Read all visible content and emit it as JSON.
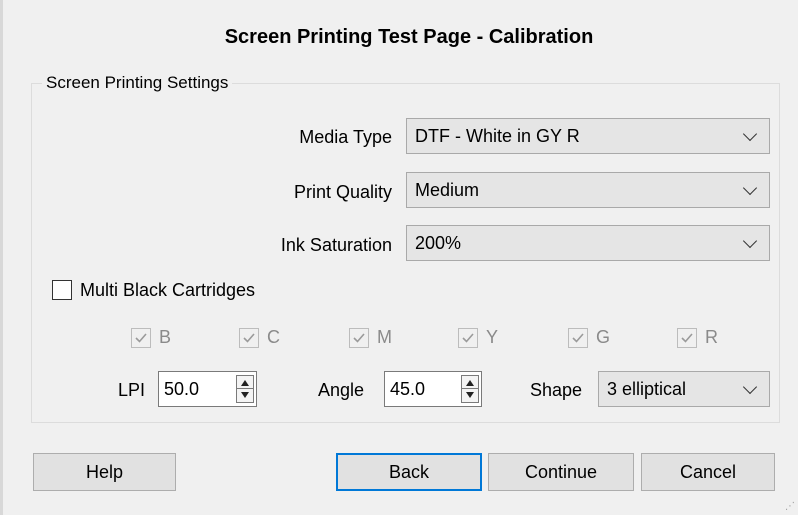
{
  "dialog": {
    "title": "Screen Printing Test Page - Calibration",
    "group_title": "Screen Printing Settings"
  },
  "settings": {
    "media_type": {
      "label": "Media Type",
      "value": "DTF - White in GY R"
    },
    "print_quality": {
      "label": "Print Quality",
      "value": "Medium"
    },
    "ink_saturation": {
      "label": "Ink Saturation",
      "value": "200%"
    }
  },
  "multi_black": {
    "label": "Multi Black Cartridges",
    "checked": false
  },
  "cartridges": [
    {
      "label": "B",
      "checked": true,
      "enabled": false
    },
    {
      "label": "C",
      "checked": true,
      "enabled": false
    },
    {
      "label": "M",
      "checked": true,
      "enabled": false
    },
    {
      "label": "Y",
      "checked": true,
      "enabled": false
    },
    {
      "label": "G",
      "checked": true,
      "enabled": false
    },
    {
      "label": "R",
      "checked": true,
      "enabled": false
    }
  ],
  "screen": {
    "lpi": {
      "label": "LPI",
      "value": "50.0"
    },
    "angle": {
      "label": "Angle",
      "value": "45.0"
    },
    "shape": {
      "label": "Shape",
      "value": "3 elliptical"
    }
  },
  "buttons": {
    "help": "Help",
    "back": "Back",
    "continue": "Continue",
    "cancel": "Cancel"
  }
}
